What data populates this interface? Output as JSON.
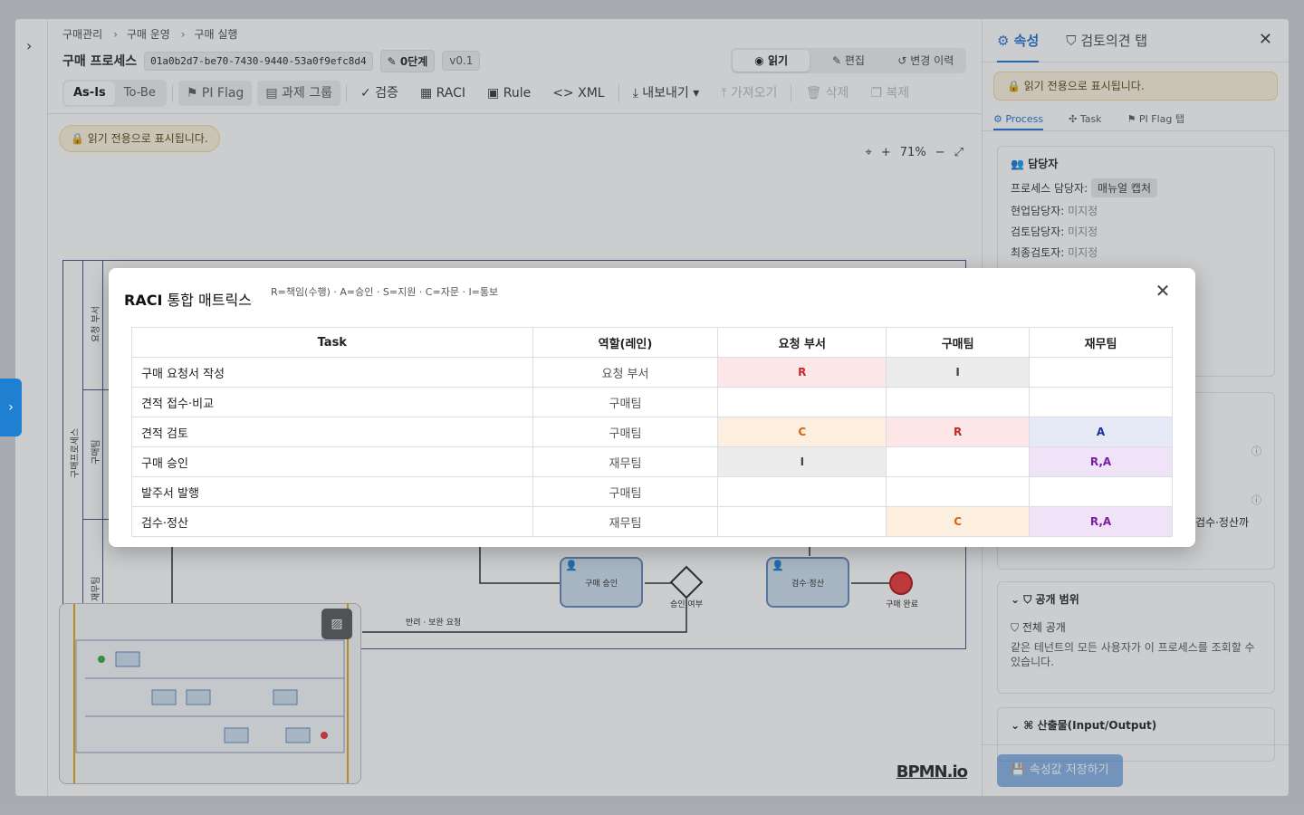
{
  "breadcrumb": [
    "구매관리",
    "구매 운영",
    "구매 실행"
  ],
  "header": {
    "title": "구매 프로세스",
    "process_id": "01a0b2d7-be70-7430-9440-53a0f9efc8d4",
    "stage": "0단계",
    "version": "v0.1"
  },
  "modes": {
    "read": "읽기",
    "edit": "편집",
    "history": "변경 이력"
  },
  "toolbar": {
    "asis": "As-Is",
    "tobe": "To-Be",
    "piflag": "PI Flag",
    "taskgroup": "과제 그룹",
    "validate": "검증",
    "raci": "RACI",
    "rule": "Rule",
    "xml": "XML",
    "export": "내보내기",
    "import": "가져오기",
    "delete": "삭제",
    "copy": "복제"
  },
  "readonly_notice": "읽기 전용으로 표시됩니다.",
  "zoom": "71%",
  "diagram": {
    "pool": "구매프로세스",
    "lanes": [
      "요청 부서",
      "구매팀",
      "재무팀"
    ],
    "tasks": {
      "approve": "구매 승인",
      "inspect": "검수·정산"
    },
    "gateway": "승인 여부",
    "end": "구매 완료",
    "flow_label": "반려 · 보완 요청",
    "watermark": "BPMN.io"
  },
  "right_panel": {
    "tab_props": "속성",
    "tab_review": "검토의견 탭",
    "subtabs": [
      "Process",
      "Task",
      "PI Flag 탭"
    ],
    "owner_section": "담당자",
    "owner_label": "프로세스 담당자:",
    "owner_value": "매뉴얼 캡처",
    "assignees": [
      {
        "label": "현업담당자:",
        "value": "미지정"
      },
      {
        "label": "검토담당자:",
        "value": "미지정"
      },
      {
        "label": "최종검토자:",
        "value": "미지정"
      }
    ],
    "partial_text": "검수·정산까",
    "visibility_section": "공개 범위",
    "visibility_value": "전체 공개",
    "visibility_desc": "같은 테넌트의 모든 사용자가 이 프로세스를 조회할 수 있습니다.",
    "io_section": "산출물(Input/Output)",
    "save_button": "속성값 저장하기"
  },
  "modal": {
    "title_bold": "RACI",
    "title_rest": " 통합 매트릭스",
    "legend": "R=책임(수행) · A=승인 · S=지원 · C=자문 · I=통보",
    "columns": [
      "Task",
      "역할(레인)",
      "요청 부서",
      "구매팀",
      "재무팀"
    ],
    "rows": [
      {
        "task": "구매 요청서 작성",
        "role": "요청 부서",
        "cells": [
          "R",
          "I",
          ""
        ]
      },
      {
        "task": "견적 접수·비교",
        "role": "구매팀",
        "cells": [
          "",
          "",
          ""
        ]
      },
      {
        "task": "견적 검토",
        "role": "구매팀",
        "cells": [
          "C",
          "R",
          "A"
        ]
      },
      {
        "task": "구매 승인",
        "role": "재무팀",
        "cells": [
          "I",
          "",
          "R,A"
        ]
      },
      {
        "task": "발주서 발행",
        "role": "구매팀",
        "cells": [
          "",
          "",
          ""
        ]
      },
      {
        "task": "검수·정산",
        "role": "재무팀",
        "cells": [
          "",
          "C",
          "R,A"
        ]
      }
    ]
  },
  "colors": {
    "accent": "#1f6fd1",
    "R": "#c62828",
    "A": "#1d2fa0",
    "C": "#d9620c",
    "RA": "#7b1fa2"
  }
}
